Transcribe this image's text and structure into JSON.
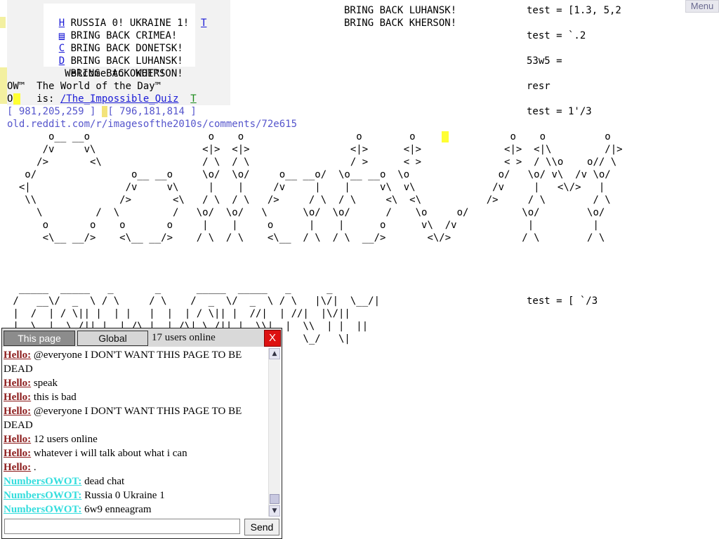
{
  "menu": {
    "label": "Menu"
  },
  "world": {
    "lines": [
      {
        "text": "H RUSSIA 0! UKRAINE 1!  T",
        "key": "l1"
      },
      {
        "text": "  BRING BACK CRIMEA!",
        "key": "l2"
      },
      {
        "text": "C BRING BACK DONETSK!",
        "key": "l3"
      },
      {
        "text": "D BRING BACK LUHANSK!",
        "key": "l4"
      },
      {
        "text": "  BRING BACK KHERSON!",
        "key": "l5"
      },
      {
        "text": "     Welcome to OWOT™!",
        "key": "l6"
      }
    ],
    "right_col": [
      "BRING BACK LUHANSK!",
      "BRING BACK KHERSON!"
    ],
    "test_lines": [
      "test = [1.3, 5,2",
      "test = `.2",
      "53w5 =",
      "resr",
      "test = 1'/3",
      "test = [ `/3"
    ],
    "wotd_label": "OW™  The World of the Day™",
    "wotd_is": "O    is: ",
    "wotd_link": "/The_Impossible_Quiz",
    "wotd_t": "T",
    "coords_a": "[ 981,205,259 ]",
    "coords_b": "[ 796,181,814 ]",
    "url": "old.reddit.com/r/imagesofthe2010s/comments/72e615",
    "ascii_block": "       o__ __o                    o    o                   o        o                o    o          o\n      /v     v\\                  <|>  <|>                 <|>      <|>              <|>  <|\\         /|>\n     />       <\\                 / \\  / \\                 / >      < >              < >  / \\\\o    o// \\\n   o/                o__ __o     \\o/  \\o/     o__ __o/  \\o__ __o  \\o               o/   \\o/ v\\  /v \\o/\n  <|                /v     v\\     |    |     /v     |    |     v\\  v\\             /v     |   <\\/>   |\n   \\\\              />       <\\   / \\  / \\   />     / \\  / \\     <\\  <\\           />     / \\        / \\\n     \\         /  \\         /   \\o/  \\o/   \\      \\o/  \\o/      /    \\o     o/         \\o/        \\o/\n      o       o    o       o     |    |     o      |    |      o      v\\  /v            |          |\n      <\\__ __/>    <\\__ __/>    / \\  / \\    <\\__  / \\  / \\  __/>       <\\/>            / \\        / \\",
    "ascii_block2": "  _____  _____   _       _      _____  _____   _      _\n /   __\\/  _  \\ / \\     / \\    /  _  \\/  _  \\ / \\   |\\/|  \\__/|\n |  /  | / \\|| |  | |   |  |  | / \\|| |  //|  | //|  |\\/||\n |  \\__|  \\_/|| |  |_/\\ |  |_/\\| \\_/|| |  \\\\|  |  \\\\  | |  ||\n  \\____/\\____/ \\____/\\____/\\____/\\_/  \\_/  \\_/    \\_/   \\|"
  },
  "chat": {
    "tab_this": "This page",
    "tab_global": "Global",
    "users_online": "17 users online",
    "close": "X",
    "send": "Send",
    "messages": [
      {
        "nick": "Hello:",
        "color": "red",
        "text": "@everyone I DON'T WANT THIS PAGE TO BE DEAD"
      },
      {
        "nick": "Hello:",
        "color": "red",
        "text": "speak"
      },
      {
        "nick": "Hello:",
        "color": "red",
        "text": "this is bad"
      },
      {
        "nick": "Hello:",
        "color": "red",
        "text": "@everyone I DON'T WANT THIS PAGE TO BE DEAD"
      },
      {
        "nick": "Hello:",
        "color": "red",
        "text": "12 users online"
      },
      {
        "nick": "Hello:",
        "color": "red",
        "text": "whatever i will talk about what i can"
      },
      {
        "nick": "Hello:",
        "color": "red",
        "text": "."
      },
      {
        "nick": "NumbersOWOT:",
        "color": "cyan",
        "text": "dead chat"
      },
      {
        "nick": "NumbersOWOT:",
        "color": "cyan",
        "text": "Russia 0 Ukraine 1"
      },
      {
        "nick": "NumbersOWOT:",
        "color": "cyan",
        "text": "6w9 enneagram"
      }
    ]
  }
}
